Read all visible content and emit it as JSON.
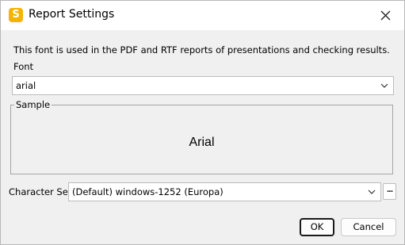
{
  "window": {
    "title": "Report Settings",
    "icon_letter": "S",
    "accent_color": "#f4b400"
  },
  "description": "This font is used in the PDF and RTF reports of presentations and checking results.",
  "font": {
    "label": "Font",
    "value": "arial"
  },
  "sample": {
    "label": "Sample",
    "text": "Arial"
  },
  "charset": {
    "label": "Character Set",
    "value": "(Default) windows-1252 (Europa)",
    "more_label": "..."
  },
  "buttons": {
    "ok": "OK",
    "cancel": "Cancel"
  }
}
